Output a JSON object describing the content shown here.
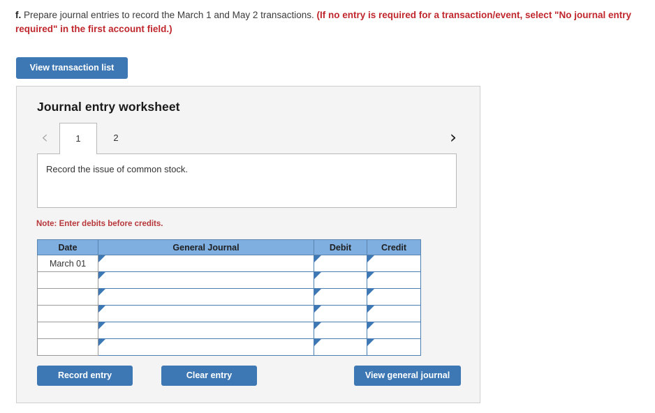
{
  "prompt": {
    "letter": "f.",
    "black_text": " Prepare journal entries to record the March 1 and May 2 transactions. ",
    "red_text": "(If no entry is required for a transaction/event, select \"No journal entry required\" in the first account field.)"
  },
  "toolbar": {
    "view_transaction_list_label": "View transaction list"
  },
  "panel": {
    "title": "Journal entry worksheet",
    "tabs": [
      {
        "label": "1",
        "active": true
      },
      {
        "label": "2",
        "active": false
      }
    ],
    "nav": {
      "prev_icon": "chevron-left-icon",
      "next_icon": "chevron-right-icon",
      "prev_glyph": "‹",
      "next_glyph": "›"
    },
    "description": "Record the issue of common stock.",
    "note": "Note: Enter debits before credits."
  },
  "table": {
    "headers": [
      "Date",
      "General Journal",
      "Debit",
      "Credit"
    ],
    "rows": [
      {
        "date": "March 01",
        "journal": "",
        "debit": "",
        "credit": ""
      },
      {
        "date": "",
        "journal": "",
        "debit": "",
        "credit": ""
      },
      {
        "date": "",
        "journal": "",
        "debit": "",
        "credit": ""
      },
      {
        "date": "",
        "journal": "",
        "debit": "",
        "credit": ""
      },
      {
        "date": "",
        "journal": "",
        "debit": "",
        "credit": ""
      },
      {
        "date": "",
        "journal": "",
        "debit": "",
        "credit": ""
      }
    ]
  },
  "actions": {
    "record_entry_label": "Record entry",
    "clear_entry_label": "Clear entry",
    "view_general_journal_label": "View general journal"
  },
  "colors": {
    "button_blue": "#3d78b5",
    "table_header_blue": "#7fafe0",
    "cell_border_blue": "#4a7fb5",
    "note_red": "#b8373b",
    "prompt_red": "#c0272d",
    "panel_bg": "#f4f4f4"
  }
}
